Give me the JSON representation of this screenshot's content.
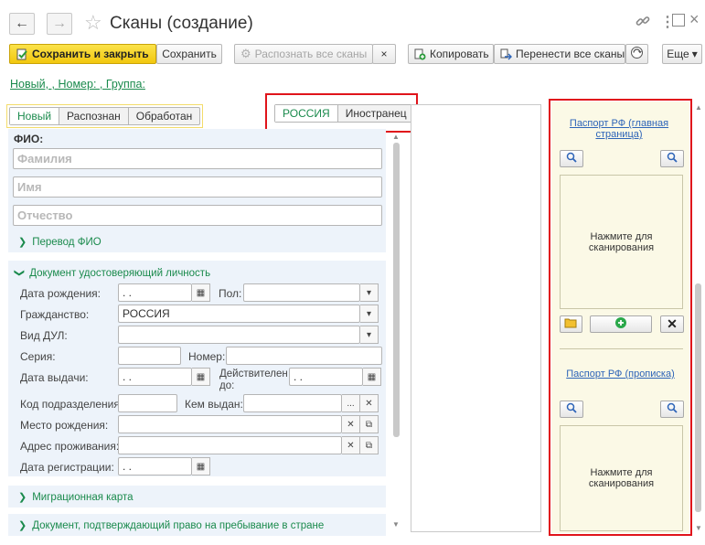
{
  "window": {
    "title": "Сканы (создание)",
    "more_icon": "vertical-dots-icon",
    "link_icon": "link-icon",
    "maximize_icon": "maximize-icon",
    "close_icon": "close-icon"
  },
  "toolbar": {
    "save_close": "Сохранить и закрыть",
    "save": "Сохранить",
    "recognize_all": "Распознать все сканы",
    "clear_mark": "×",
    "copy": "Копировать",
    "transfer_all": "Перенести все сканы",
    "more": "Еще",
    "more_arrow": "▾"
  },
  "breadcrumb": "Новый, , Номер: , Группа:",
  "status_tabs": [
    "Новый",
    "Распознан",
    "Обработан"
  ],
  "country_tabs": [
    "РОССИЯ",
    "Иностранец"
  ],
  "fio": {
    "label": "ФИО:",
    "lastname_placeholder": "Фамилия",
    "firstname_placeholder": "Имя",
    "patronymic_placeholder": "Отчество",
    "translate_link": "Перевод ФИО"
  },
  "document": {
    "group_title": "Документ удостоверяющий личность",
    "birth_date_label": "Дата рождения:",
    "birth_date_value": " .  .",
    "gender_label": "Пол:",
    "gender_value": "",
    "citizenship_label": "Гражданство:",
    "citizenship_value": "РОССИЯ",
    "dul_type_label": "Вид ДУЛ:",
    "dul_type_value": "",
    "series_label": "Серия:",
    "series_value": "",
    "number_label": "Номер:",
    "number_value": "",
    "issue_date_label": "Дата выдачи:",
    "issue_date_value": " .  .",
    "valid_label_1": "Действителен",
    "valid_label_2": "до:",
    "valid_value": " .  .",
    "division_code_label": "Код подразделения:",
    "division_code_value": "",
    "issued_by_label": "Кем выдан:",
    "issued_by_value": "",
    "ellipsis": "...",
    "birth_place_label": "Место рождения:",
    "birth_place_value": "",
    "address_label": "Адрес проживания:",
    "address_value": "",
    "registration_date_label": "Дата регистрации:",
    "registration_date_value": " .  ."
  },
  "collapsed_groups": {
    "migration_card": "Миграционная карта",
    "stay_document": "Документ, подтверждающий право на пребывание в стране"
  },
  "scans": [
    {
      "title": "Паспорт РФ (главная страница)",
      "placeholder": "Нажмите для сканирования"
    },
    {
      "title": "Паспорт РФ (прописка)",
      "placeholder": "Нажмите для сканирования"
    }
  ],
  "colors": {
    "accent_green": "#1a8a4c",
    "highlight_red": "#e0141b",
    "primary_yellow": "#f2c70e",
    "panel_blue": "#edf3fa",
    "scan_area": "#fbf9e6",
    "scan_link": "#2d64b8"
  }
}
